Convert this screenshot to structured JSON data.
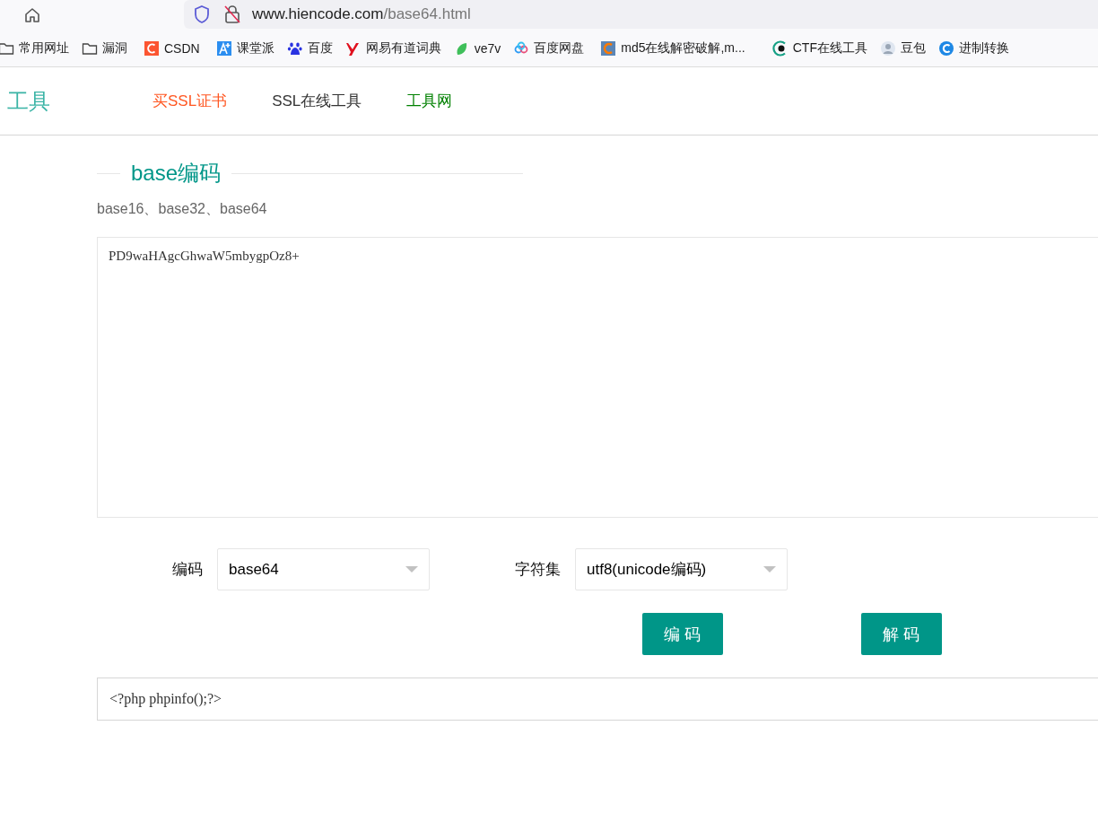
{
  "browser": {
    "url_host": "www.hiencode.com",
    "url_path": "/base64.html"
  },
  "bookmarks": [
    {
      "label": "常用网址",
      "kind": "folder"
    },
    {
      "label": "漏洞",
      "kind": "folder"
    },
    {
      "label": "CSDN",
      "kind": "csdn"
    },
    {
      "label": "课堂派",
      "kind": "ketang"
    },
    {
      "label": "百度",
      "kind": "baidu"
    },
    {
      "label": "网易有道词典",
      "kind": "youdao"
    },
    {
      "label": "ve7v",
      "kind": "leaf"
    },
    {
      "label": "百度网盘",
      "kind": "pan"
    },
    {
      "label": "md5在线解密破解,m...",
      "kind": "md5"
    },
    {
      "label": "CTF在线工具",
      "kind": "ctf"
    },
    {
      "label": "豆包",
      "kind": "avatar"
    },
    {
      "label": "进制转换",
      "kind": "jinzhi"
    }
  ],
  "site": {
    "logo": "工具",
    "nav": [
      {
        "label": "买SSL证书",
        "color": "#ff5722"
      },
      {
        "label": "SSL在线工具",
        "color": "#333333"
      },
      {
        "label": "工具网",
        "color": "#008000"
      }
    ]
  },
  "section": {
    "title": "base编码",
    "subtitle": "base16、base32、base64"
  },
  "input": {
    "value": "PD9waHAgcGhwaW5mbygpOz8+"
  },
  "selects": [
    {
      "label": "编码",
      "value": "base64"
    },
    {
      "label": "字符集",
      "value": "utf8(unicode编码)"
    }
  ],
  "buttons": [
    "编 码",
    "解 码"
  ],
  "output": {
    "value": "<?php phpinfo();?>"
  }
}
